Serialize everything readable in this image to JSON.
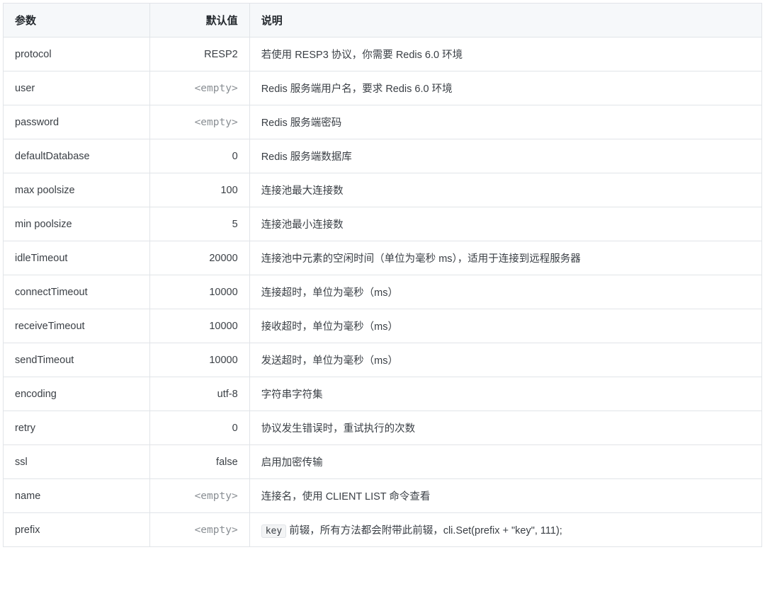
{
  "table": {
    "headers": {
      "param": "参数",
      "default": "默认值",
      "desc": "说明"
    },
    "rows": [
      {
        "param": "protocol",
        "default": "RESP2",
        "default_kind": "plain",
        "desc_plain": "若使用 RESP3 协议，你需要 Redis 6.0 环境"
      },
      {
        "param": "user",
        "default": "<empty>",
        "default_kind": "empty",
        "desc_plain": "Redis 服务端用户名，要求 Redis 6.0 环境"
      },
      {
        "param": "password",
        "default": "<empty>",
        "default_kind": "empty",
        "desc_plain": "Redis 服务端密码"
      },
      {
        "param": "defaultDatabase",
        "default": "0",
        "default_kind": "plain",
        "desc_plain": "Redis 服务端数据库"
      },
      {
        "param": "max poolsize",
        "default": "100",
        "default_kind": "plain",
        "desc_plain": "连接池最大连接数"
      },
      {
        "param": "min poolsize",
        "default": "5",
        "default_kind": "plain",
        "desc_plain": "连接池最小连接数"
      },
      {
        "param": "idleTimeout",
        "default": "20000",
        "default_kind": "plain",
        "desc_plain": "连接池中元素的空闲时间（单位为毫秒 ms），适用于连接到远程服务器"
      },
      {
        "param": "connectTimeout",
        "default": "10000",
        "default_kind": "plain",
        "desc_plain": "连接超时，单位为毫秒（ms）"
      },
      {
        "param": "receiveTimeout",
        "default": "10000",
        "default_kind": "plain",
        "desc_plain": "接收超时，单位为毫秒（ms）"
      },
      {
        "param": "sendTimeout",
        "default": "10000",
        "default_kind": "plain",
        "desc_plain": "发送超时，单位为毫秒（ms）"
      },
      {
        "param": "encoding",
        "default": "utf-8",
        "default_kind": "plain",
        "desc_plain": "字符串字符集"
      },
      {
        "param": "retry",
        "default": "0",
        "default_kind": "plain",
        "desc_plain": "协议发生错误时，重试执行的次数"
      },
      {
        "param": "ssl",
        "default": "false",
        "default_kind": "plain",
        "desc_plain": "启用加密传输"
      },
      {
        "param": "name",
        "default": "<empty>",
        "default_kind": "empty",
        "desc_plain": "连接名，使用 CLIENT LIST 命令查看"
      },
      {
        "param": "prefix",
        "default": "<empty>",
        "default_kind": "empty",
        "desc_code": "key",
        "desc_after": " 前辍，所有方法都会附带此前辍，cli.Set(prefix + \"key\", 111);"
      }
    ]
  }
}
